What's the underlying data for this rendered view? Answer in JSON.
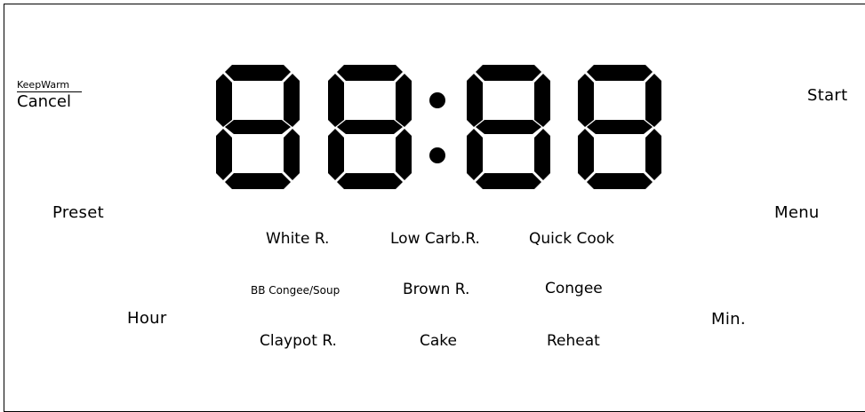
{
  "display": {
    "digits": [
      "8",
      "8",
      "8",
      "8"
    ],
    "separator": ":"
  },
  "keep_warm_cancel": {
    "top": "KeepWarm",
    "bottom": "Cancel"
  },
  "buttons": {
    "start": "Start",
    "preset": "Preset",
    "menu": "Menu",
    "hour": "Hour",
    "min": "Min."
  },
  "programs": {
    "white_rice": "White R.",
    "low_carb_rice": "Low Carb.R.",
    "quick_cook": "Quick Cook",
    "bb_congee_soup": "BB Congee/Soup",
    "brown_rice": "Brown R.",
    "congee": "Congee",
    "claypot_rice": "Claypot R.",
    "cake": "Cake",
    "reheat": "Reheat"
  }
}
